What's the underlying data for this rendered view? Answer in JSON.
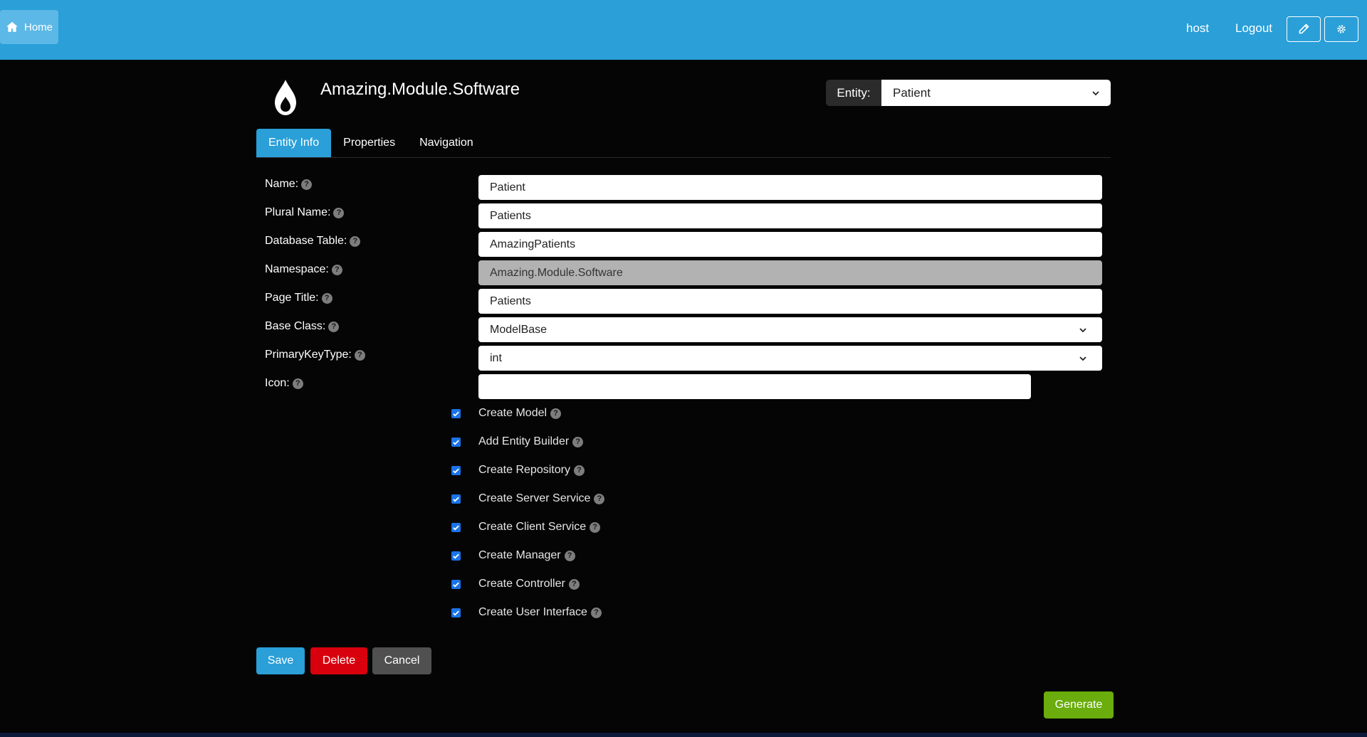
{
  "navbar": {
    "home_label": "Home",
    "user_label": "host",
    "logout_label": "Logout"
  },
  "module": {
    "title": "Amazing.Module.Software"
  },
  "entity_picker": {
    "label": "Entity:",
    "selected": "Patient"
  },
  "tabs": [
    {
      "label": "Entity Info",
      "active": true
    },
    {
      "label": "Properties",
      "active": false
    },
    {
      "label": "Navigation",
      "active": false
    }
  ],
  "form": {
    "name": {
      "label": "Name:",
      "value": "Patient"
    },
    "plural_name": {
      "label": "Plural Name:",
      "value": "Patients"
    },
    "database_table": {
      "label": "Database Table:",
      "value": "AmazingPatients"
    },
    "namespace": {
      "label": "Namespace:",
      "value": "Amazing.Module.Software"
    },
    "page_title": {
      "label": "Page Title:",
      "value": "Patients"
    },
    "base_class": {
      "label": "Base Class:",
      "value": "ModelBase"
    },
    "primary_key_type": {
      "label": "PrimaryKeyType:",
      "value": "int"
    },
    "icon": {
      "label": "Icon:",
      "value": ""
    }
  },
  "options": [
    {
      "label": "Create Model",
      "checked": true
    },
    {
      "label": "Add Entity Builder",
      "checked": true
    },
    {
      "label": "Create Repository",
      "checked": true
    },
    {
      "label": "Create Server Service",
      "checked": true
    },
    {
      "label": "Create Client Service",
      "checked": true
    },
    {
      "label": "Create Manager",
      "checked": true
    },
    {
      "label": "Create Controller",
      "checked": true
    },
    {
      "label": "Create User Interface",
      "checked": true
    }
  ],
  "buttons": {
    "save": "Save",
    "delete": "Delete",
    "cancel": "Cancel",
    "generate": "Generate"
  },
  "help_glyph": "?",
  "icons": {
    "home": "home-icon",
    "edit": "pencil-icon",
    "settings": "gear-icon",
    "logo": "droplet-logo-icon",
    "dropdown": "chevron-down-icon",
    "checkbox": "check-icon",
    "help": "question-circle-icon"
  },
  "colors": {
    "navbar": "#2a9fd8",
    "background": "#050505",
    "primary": "#2a9fd8",
    "danger": "#d9000d",
    "secondary": "#505050",
    "success": "#6aad0c",
    "checkbox": "#1a73e8"
  }
}
